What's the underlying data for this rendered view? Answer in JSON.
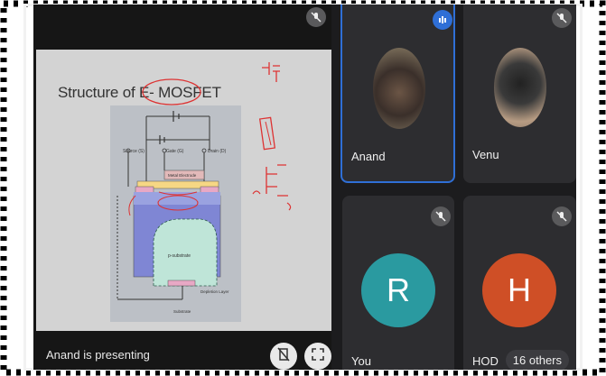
{
  "slide": {
    "title": "Structure of E- MOSFET",
    "labels": [
      "Source (S)",
      "Gate (G)",
      "Drain (D)",
      "Metal Electrode",
      "Oxide",
      "Induced n-channel",
      "p-substrate",
      "Depletion Layer",
      "Substrate"
    ]
  },
  "presenter": {
    "status": "Anand is presenting"
  },
  "participants": [
    {
      "name": "Anand"
    },
    {
      "name": "Venu"
    },
    {
      "name": "You",
      "initial": "R"
    },
    {
      "name": "HOD",
      "initial": "H"
    }
  ],
  "others": {
    "label": "16 others"
  },
  "colors": {
    "active_border": "#2f6fd6",
    "avatar_r": "#2a9aa0",
    "avatar_h": "#cf4f26",
    "tile_bg": "#2d2d30"
  },
  "icons": {
    "present_cancel": "presentation-off-icon",
    "fullscreen": "fullscreen-icon",
    "mic_off": "mic-off-icon",
    "audio_level": "audio-level-icon"
  }
}
